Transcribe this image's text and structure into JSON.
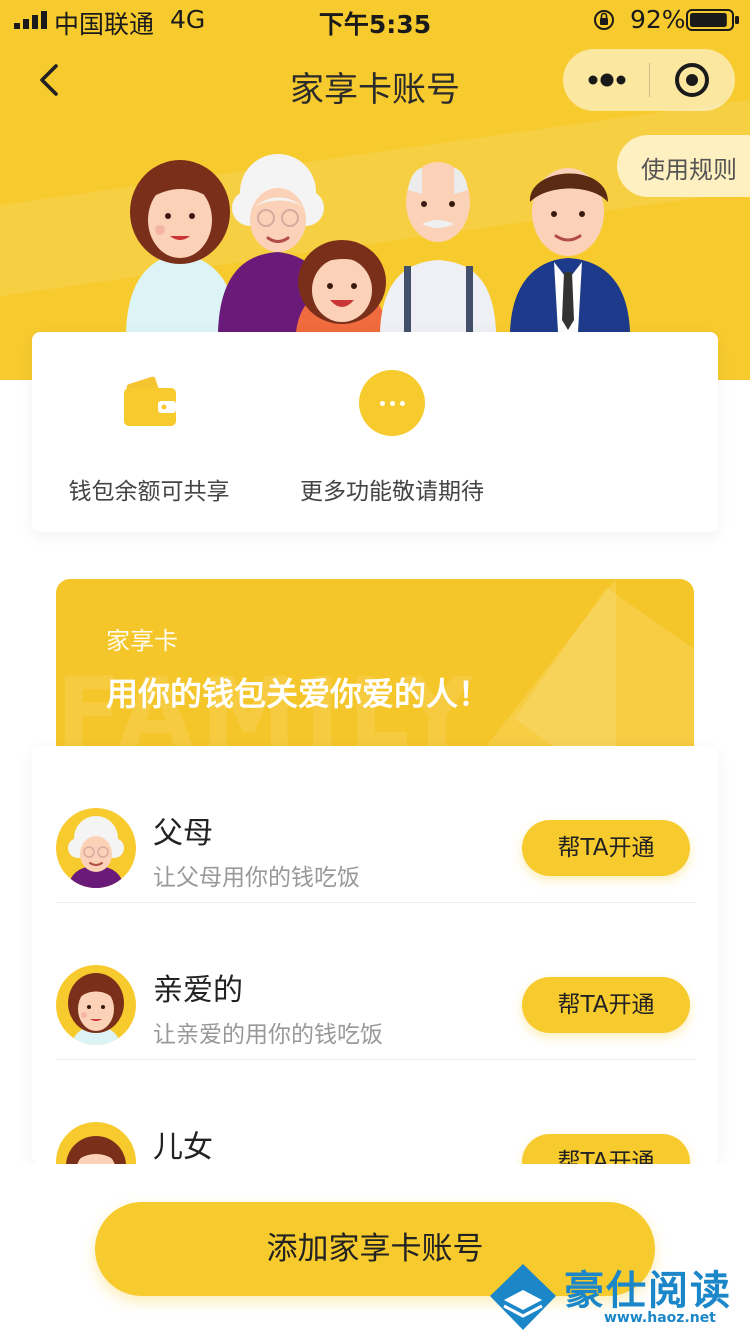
{
  "status_bar": {
    "carrier": "中国联通",
    "network": "4G",
    "time": "下午5:35",
    "battery_percent": "92%",
    "battery_level": 0.92
  },
  "nav": {
    "title": "家享卡账号",
    "back_icon": "chevron-left-icon",
    "more_icon": "more-dots-icon",
    "close_icon": "target-circle-icon"
  },
  "hero": {
    "rules_label": "使用规则"
  },
  "features": [
    {
      "icon": "wallet-icon",
      "label": "钱包余额可共享"
    },
    {
      "icon": "more-dots-icon",
      "label": "更多功能敬请期待"
    }
  ],
  "banner": {
    "subtitle": "家享卡",
    "title": "用你的钱包关爱你爱的人！",
    "watermark": "FAMILY"
  },
  "members": [
    {
      "title": "父母",
      "desc": "让父母用你的钱吃饭",
      "button": "帮TA开通"
    },
    {
      "title": "亲爱的",
      "desc": "让亲爱的用你的钱吃饭",
      "button": "帮TA开通"
    },
    {
      "title": "儿女",
      "desc": "",
      "button": "帮TA开通"
    }
  ],
  "bottom": {
    "add_button": "添加家享卡账号"
  },
  "watermark": {
    "name": "豪仕阅读",
    "url": "www.haoz.net"
  },
  "colors": {
    "accent": "#F7CA2E",
    "background": "#FFFFFF",
    "text": "#333333",
    "subtext": "#999999"
  }
}
